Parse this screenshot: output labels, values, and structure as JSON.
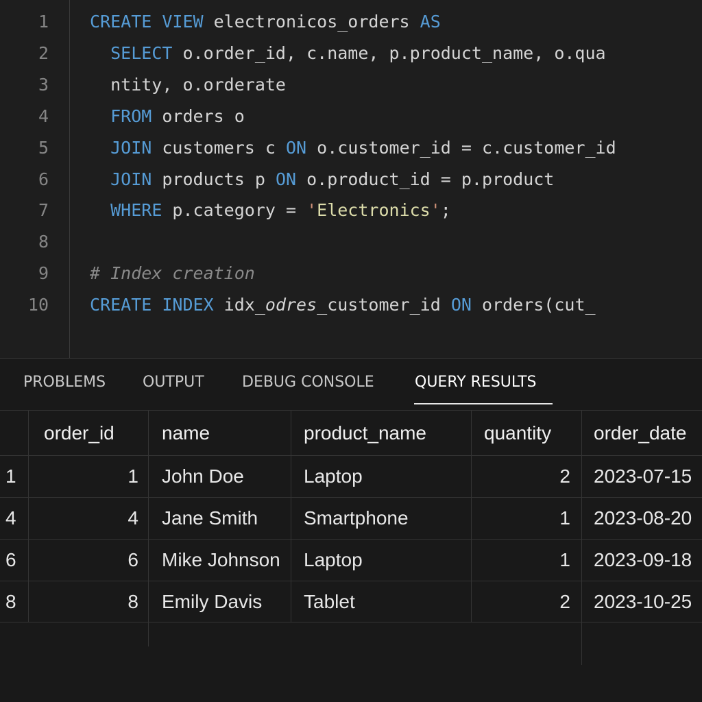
{
  "editor": {
    "line_numbers": [
      "1",
      "2",
      "3",
      "4",
      "5",
      "6",
      "7",
      "8",
      "9",
      "10"
    ],
    "lines": [
      [
        {
          "t": "CREATE VIEW",
          "c": "kw"
        },
        {
          "t": " electronicos_orders ",
          "c": ""
        },
        {
          "t": "AS",
          "c": "kw"
        }
      ],
      [
        {
          "t": "  ",
          "c": ""
        },
        {
          "t": "SELECT",
          "c": "kw"
        },
        {
          "t": " o.order_id, c.name, p.product_name, o.qua",
          "c": ""
        }
      ],
      [
        {
          "t": "  ntity, o.orderate",
          "c": ""
        }
      ],
      [
        {
          "t": "  ",
          "c": ""
        },
        {
          "t": "FROM",
          "c": "kw"
        },
        {
          "t": " orders o",
          "c": ""
        }
      ],
      [
        {
          "t": "  ",
          "c": ""
        },
        {
          "t": "JOIN",
          "c": "kw"
        },
        {
          "t": " customers c ",
          "c": ""
        },
        {
          "t": "ON",
          "c": "kw"
        },
        {
          "t": " o.customer_id = c.customer_id",
          "c": ""
        }
      ],
      [
        {
          "t": "  ",
          "c": ""
        },
        {
          "t": "JOIN",
          "c": "kw"
        },
        {
          "t": " products p ",
          "c": ""
        },
        {
          "t": "ON",
          "c": "kw"
        },
        {
          "t": " o.product_id = p.product",
          "c": ""
        }
      ],
      [
        {
          "t": "  ",
          "c": ""
        },
        {
          "t": "WHERE",
          "c": "kw"
        },
        {
          "t": " p.category = ",
          "c": ""
        },
        {
          "t": "'",
          "c": "str"
        },
        {
          "t": "Electronics",
          "c": "str-inner"
        },
        {
          "t": "'",
          "c": "str"
        },
        {
          "t": ";",
          "c": ""
        }
      ],
      [],
      [
        {
          "t": "# Index creation",
          "c": "comment"
        }
      ],
      [
        {
          "t": "CREATE INDEX",
          "c": "kw"
        },
        {
          "t": " idx_",
          "c": ""
        },
        {
          "t": "odres",
          "c": "ital"
        },
        {
          "t": "_customer_id ",
          "c": ""
        },
        {
          "t": "ON",
          "c": "kw"
        },
        {
          "t": " orders(cut_",
          "c": ""
        }
      ]
    ]
  },
  "panel": {
    "tabs": [
      {
        "label": "PROBLEMS",
        "active": false
      },
      {
        "label": "OUTPUT",
        "active": false
      },
      {
        "label": "DEBUG CONSOLE",
        "active": false
      },
      {
        "label": "QUERY RESULTS",
        "active": true
      }
    ]
  },
  "results": {
    "columns": [
      "order_id",
      "name",
      "product_name",
      "quantity",
      "order_date"
    ],
    "rows": [
      {
        "row": "1",
        "order_id": "1",
        "name": "John Doe",
        "product_name": "Laptop",
        "quantity": "2",
        "order_date": "2023-07-15"
      },
      {
        "row": "4",
        "order_id": "4",
        "name": "Jane Smith",
        "product_name": "Smartphone",
        "quantity": "1",
        "order_date": "2023-08-20"
      },
      {
        "row": "6",
        "order_id": "6",
        "name": "Mike Johnson",
        "product_name": "Laptop",
        "quantity": "1",
        "order_date": "2023-09-18"
      },
      {
        "row": "8",
        "order_id": "8",
        "name": "Emily Davis",
        "product_name": "Tablet",
        "quantity": "2",
        "order_date": "2023-10-25"
      }
    ]
  },
  "colors": {
    "keyword": "#569cd6",
    "string": "#ce9178",
    "comment": "#8a8a8a",
    "background": "#1e1e1e"
  }
}
